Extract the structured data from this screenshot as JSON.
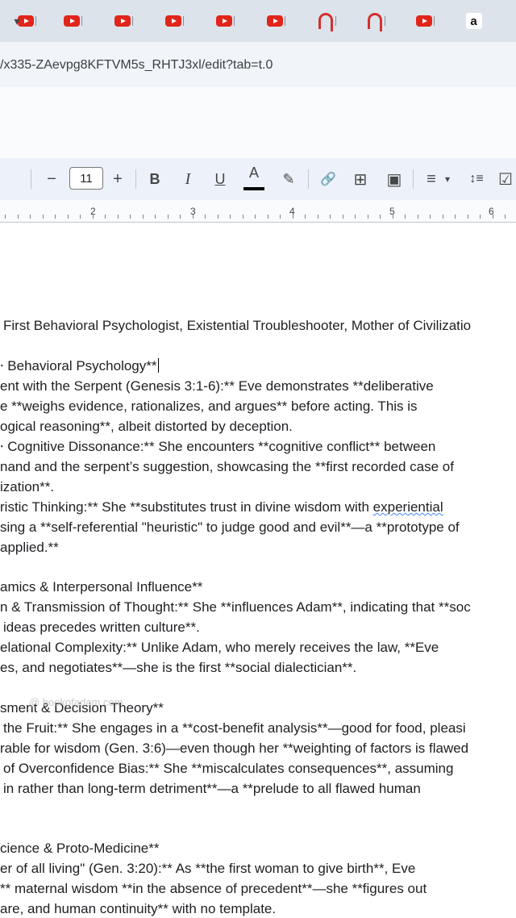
{
  "browser": {
    "tabs": [
      {
        "icon": "youtube-icon"
      },
      {
        "icon": "youtube-icon"
      },
      {
        "icon": "youtube-icon"
      },
      {
        "icon": "youtube-icon"
      },
      {
        "icon": "youtube-icon"
      },
      {
        "icon": "youtube-icon"
      },
      {
        "icon": "hook-icon"
      },
      {
        "icon": "hook-icon"
      },
      {
        "icon": "youtube-icon"
      },
      {
        "icon": "amazon-icon",
        "glyph": "a"
      }
    ],
    "url": "/x335-ZAevpg8KFTVM5s_RHTJ3xl/edit?tab=t.0"
  },
  "toolbar": {
    "dropdown_arrow": "▾",
    "decrease_font": "−",
    "font_size": "11",
    "increase_font": "+",
    "bold": "B",
    "italic": "I",
    "underline": "U",
    "text_color": "A",
    "highlight": "✎",
    "link": "🔗",
    "add_comment": "⊞",
    "insert_image": "▣",
    "align": "≡",
    "align_arrow": "▾",
    "line_spacing": "↕≡",
    "checklist": "☑"
  },
  "ruler": {
    "numbers": [
      "2",
      "3",
      "4",
      "5",
      "6"
    ]
  },
  "document": {
    "lines": [
      "First Behavioral Psychologist, Existential Troubleshooter, Mother of Civilizatio",
      "Behavioral Psychology**",
      "ent with the Serpent (Genesis 3:1-6):** Eve demonstrates **deliberative",
      "e **weighs evidence, rationalizes, and argues** before acting. This is",
      "ogical reasoning**, albeit distorted by deception.",
      "Cognitive Dissonance:** She encounters **cognitive conflict** between",
      "nand and the serpent’s suggestion, showcasing the **first recorded case of",
      "ization**.",
      "ristic Thinking:** She **substitutes trust in divine wisdom with ",
      "sing a **self-referential \"heuristic\" to judge good and evil**—a **prototype of",
      "applied.**",
      "amics & Interpersonal Influence**",
      "n & Transmission of Thought:** She **influences Adam**, indicating that **soc",
      "ideas precedes written culture**.",
      "elational Complexity:** Unlike Adam, who merely receives the law, **Eve",
      "es, and negotiates**—she is the first **social dialectician**.",
      "sment & Decision Theory**",
      "the Fruit:** She engages in a **cost-benefit analysis**—good for food, pleasi",
      "rable for wisdom (Gen. 3:6)—even though her **weighting of factors is flawed",
      "of Overconfidence Bias:** She **miscalculates consequences**, assuming",
      "in rather than long-term detriment**—a **prelude to all flawed human",
      "cience & Proto-Medicine**",
      "er of all living\" (Gen. 3:20):** As **the first woman to give birth**, Eve",
      "** maternal wisdom **in the absence of precedent**—she **figures out",
      "are, and human continuity** with no template."
    ],
    "squiggle_word": "experiential",
    "overlay_text": "@ bookofadam.com"
  }
}
